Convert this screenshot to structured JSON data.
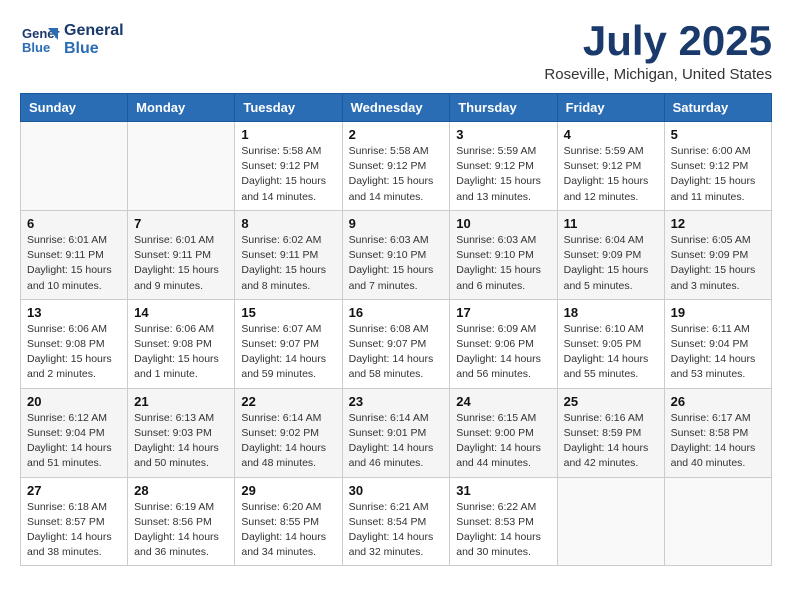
{
  "header": {
    "logo_line1": "General",
    "logo_line2": "Blue",
    "month_year": "July 2025",
    "location": "Roseville, Michigan, United States"
  },
  "weekdays": [
    "Sunday",
    "Monday",
    "Tuesday",
    "Wednesday",
    "Thursday",
    "Friday",
    "Saturday"
  ],
  "weeks": [
    [
      {
        "day": "",
        "info": ""
      },
      {
        "day": "",
        "info": ""
      },
      {
        "day": "1",
        "info": "Sunrise: 5:58 AM\nSunset: 9:12 PM\nDaylight: 15 hours\nand 14 minutes."
      },
      {
        "day": "2",
        "info": "Sunrise: 5:58 AM\nSunset: 9:12 PM\nDaylight: 15 hours\nand 14 minutes."
      },
      {
        "day": "3",
        "info": "Sunrise: 5:59 AM\nSunset: 9:12 PM\nDaylight: 15 hours\nand 13 minutes."
      },
      {
        "day": "4",
        "info": "Sunrise: 5:59 AM\nSunset: 9:12 PM\nDaylight: 15 hours\nand 12 minutes."
      },
      {
        "day": "5",
        "info": "Sunrise: 6:00 AM\nSunset: 9:12 PM\nDaylight: 15 hours\nand 11 minutes."
      }
    ],
    [
      {
        "day": "6",
        "info": "Sunrise: 6:01 AM\nSunset: 9:11 PM\nDaylight: 15 hours\nand 10 minutes."
      },
      {
        "day": "7",
        "info": "Sunrise: 6:01 AM\nSunset: 9:11 PM\nDaylight: 15 hours\nand 9 minutes."
      },
      {
        "day": "8",
        "info": "Sunrise: 6:02 AM\nSunset: 9:11 PM\nDaylight: 15 hours\nand 8 minutes."
      },
      {
        "day": "9",
        "info": "Sunrise: 6:03 AM\nSunset: 9:10 PM\nDaylight: 15 hours\nand 7 minutes."
      },
      {
        "day": "10",
        "info": "Sunrise: 6:03 AM\nSunset: 9:10 PM\nDaylight: 15 hours\nand 6 minutes."
      },
      {
        "day": "11",
        "info": "Sunrise: 6:04 AM\nSunset: 9:09 PM\nDaylight: 15 hours\nand 5 minutes."
      },
      {
        "day": "12",
        "info": "Sunrise: 6:05 AM\nSunset: 9:09 PM\nDaylight: 15 hours\nand 3 minutes."
      }
    ],
    [
      {
        "day": "13",
        "info": "Sunrise: 6:06 AM\nSunset: 9:08 PM\nDaylight: 15 hours\nand 2 minutes."
      },
      {
        "day": "14",
        "info": "Sunrise: 6:06 AM\nSunset: 9:08 PM\nDaylight: 15 hours\nand 1 minute."
      },
      {
        "day": "15",
        "info": "Sunrise: 6:07 AM\nSunset: 9:07 PM\nDaylight: 14 hours\nand 59 minutes."
      },
      {
        "day": "16",
        "info": "Sunrise: 6:08 AM\nSunset: 9:07 PM\nDaylight: 14 hours\nand 58 minutes."
      },
      {
        "day": "17",
        "info": "Sunrise: 6:09 AM\nSunset: 9:06 PM\nDaylight: 14 hours\nand 56 minutes."
      },
      {
        "day": "18",
        "info": "Sunrise: 6:10 AM\nSunset: 9:05 PM\nDaylight: 14 hours\nand 55 minutes."
      },
      {
        "day": "19",
        "info": "Sunrise: 6:11 AM\nSunset: 9:04 PM\nDaylight: 14 hours\nand 53 minutes."
      }
    ],
    [
      {
        "day": "20",
        "info": "Sunrise: 6:12 AM\nSunset: 9:04 PM\nDaylight: 14 hours\nand 51 minutes."
      },
      {
        "day": "21",
        "info": "Sunrise: 6:13 AM\nSunset: 9:03 PM\nDaylight: 14 hours\nand 50 minutes."
      },
      {
        "day": "22",
        "info": "Sunrise: 6:14 AM\nSunset: 9:02 PM\nDaylight: 14 hours\nand 48 minutes."
      },
      {
        "day": "23",
        "info": "Sunrise: 6:14 AM\nSunset: 9:01 PM\nDaylight: 14 hours\nand 46 minutes."
      },
      {
        "day": "24",
        "info": "Sunrise: 6:15 AM\nSunset: 9:00 PM\nDaylight: 14 hours\nand 44 minutes."
      },
      {
        "day": "25",
        "info": "Sunrise: 6:16 AM\nSunset: 8:59 PM\nDaylight: 14 hours\nand 42 minutes."
      },
      {
        "day": "26",
        "info": "Sunrise: 6:17 AM\nSunset: 8:58 PM\nDaylight: 14 hours\nand 40 minutes."
      }
    ],
    [
      {
        "day": "27",
        "info": "Sunrise: 6:18 AM\nSunset: 8:57 PM\nDaylight: 14 hours\nand 38 minutes."
      },
      {
        "day": "28",
        "info": "Sunrise: 6:19 AM\nSunset: 8:56 PM\nDaylight: 14 hours\nand 36 minutes."
      },
      {
        "day": "29",
        "info": "Sunrise: 6:20 AM\nSunset: 8:55 PM\nDaylight: 14 hours\nand 34 minutes."
      },
      {
        "day": "30",
        "info": "Sunrise: 6:21 AM\nSunset: 8:54 PM\nDaylight: 14 hours\nand 32 minutes."
      },
      {
        "day": "31",
        "info": "Sunrise: 6:22 AM\nSunset: 8:53 PM\nDaylight: 14 hours\nand 30 minutes."
      },
      {
        "day": "",
        "info": ""
      },
      {
        "day": "",
        "info": ""
      }
    ]
  ]
}
